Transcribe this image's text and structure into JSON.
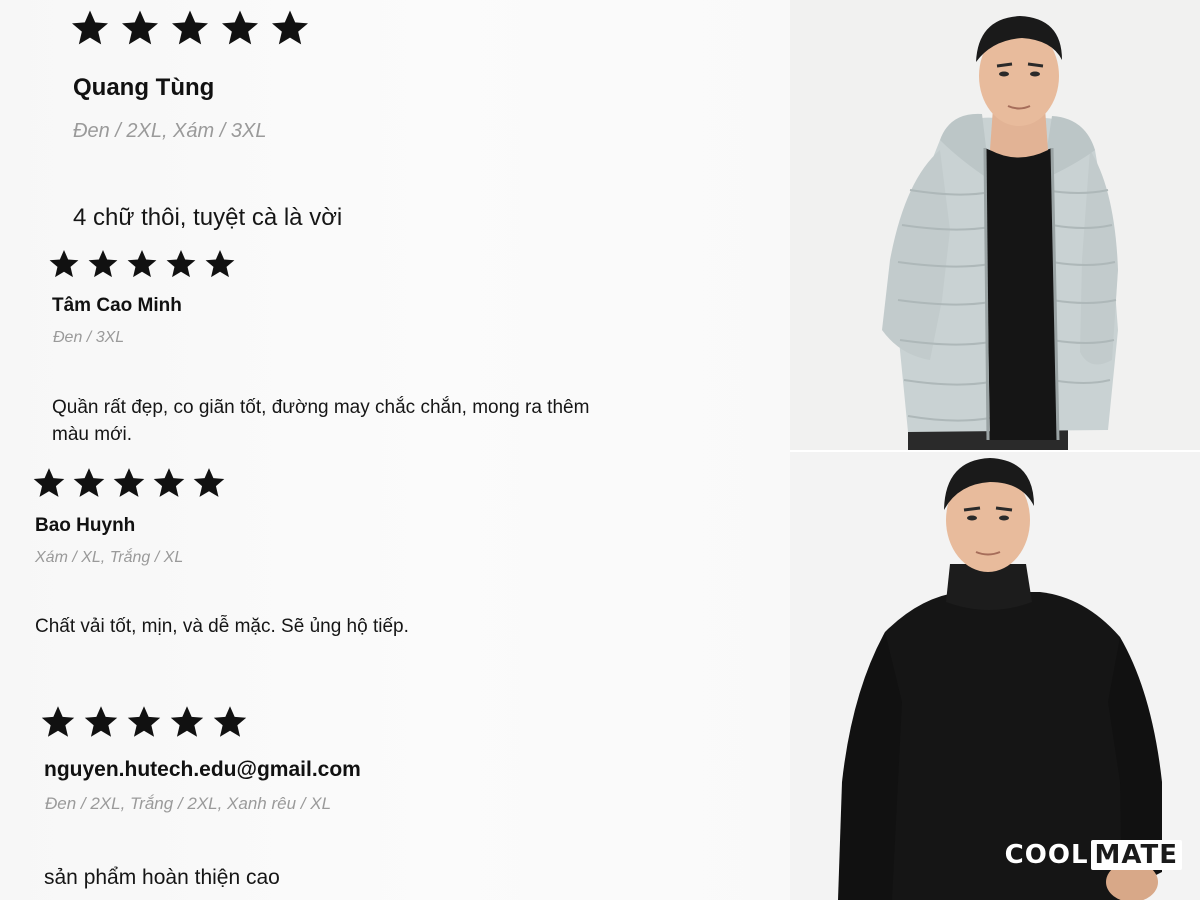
{
  "reviews": [
    {
      "rating": 5,
      "name": "Quang Tùng",
      "variants": "Đen / 2XL, Xám / 3XL",
      "comment": "4 chữ thôi, tuyệt cà là vời"
    },
    {
      "rating": 5,
      "name": "Tâm Cao Minh",
      "variants": "Đen / 3XL",
      "comment": "Quần rất đẹp, co giãn tốt, đường may chắc chắn, mong ra thêm màu mới."
    },
    {
      "rating": 5,
      "name": "Bao Huynh",
      "variants": "Xám / XL, Trắng / XL",
      "comment": "Chất vải tốt, mịn, và dễ mặc. Sẽ ủng hộ tiếp."
    },
    {
      "rating": 5,
      "name": "nguyen.hutech.edu@gmail.com",
      "variants": "Đen / 2XL, Trắng / 2XL, Xanh rêu / XL",
      "comment": "sản phẩm hoàn thiện cao"
    }
  ],
  "brand": {
    "logo_part1": "COOL",
    "logo_part2": "MATE"
  },
  "icons": {
    "star": "star-icon"
  },
  "colors": {
    "star": "#111111",
    "variant_text": "#9a9a9a",
    "jacket": "#c9d2d3",
    "shirt": "#151515"
  }
}
